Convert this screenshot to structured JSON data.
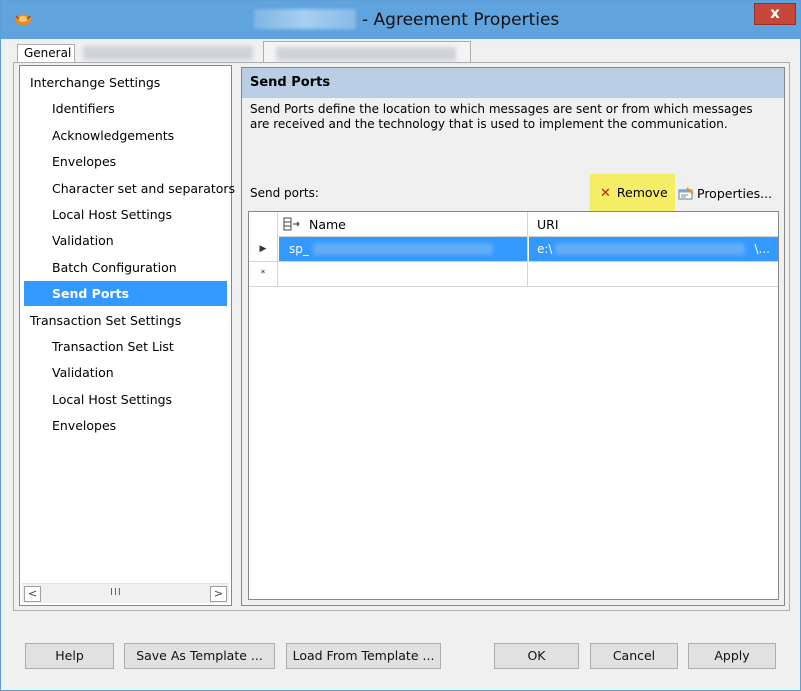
{
  "window": {
    "title": "- Agreement Properties",
    "close_glyph": "x"
  },
  "tabs": {
    "general_label": "General"
  },
  "nav": {
    "items": [
      {
        "label": "Interchange Settings",
        "level": "top"
      },
      {
        "label": "Identifiers",
        "level": "sub"
      },
      {
        "label": "Acknowledgements",
        "level": "sub"
      },
      {
        "label": "Envelopes",
        "level": "sub"
      },
      {
        "label": "Character set and separators",
        "level": "sub"
      },
      {
        "label": "Local Host Settings",
        "level": "sub"
      },
      {
        "label": "Validation",
        "level": "sub"
      },
      {
        "label": "Batch Configuration",
        "level": "sub"
      },
      {
        "label": "Send Ports",
        "level": "sub",
        "selected": true
      },
      {
        "label": "Transaction Set Settings",
        "level": "top"
      },
      {
        "label": "Transaction Set List",
        "level": "sub"
      },
      {
        "label": "Validation",
        "level": "sub"
      },
      {
        "label": "Local Host Settings",
        "level": "sub"
      },
      {
        "label": "Envelopes",
        "level": "sub"
      }
    ],
    "scroll_left": "<",
    "scroll_right": ">",
    "scroll_grip": "III"
  },
  "content": {
    "header": "Send Ports",
    "description": "Send Ports define the location to which messages are sent or from which messages are received and the technology that is used to implement the communication.",
    "send_ports_label": "Send ports:",
    "remove_label": "Remove",
    "properties_label": "Properties..."
  },
  "grid": {
    "columns": [
      "Name",
      "URI"
    ],
    "rows": [
      {
        "indicator": "▶",
        "name": "sp_",
        "uri": "e:\\",
        "uri_end": "\\..."
      },
      {
        "indicator": "*",
        "name": "",
        "uri": "",
        "uri_end": ""
      }
    ]
  },
  "footer": {
    "help": "Help",
    "save_template": "Save As Template ...",
    "load_template": "Load From Template ...",
    "ok": "OK",
    "cancel": "Cancel",
    "apply": "Apply"
  },
  "colors": {
    "titlebar": "#5fa3df",
    "selection": "#3399ff",
    "header_band": "#b9cde5",
    "highlight": "#f5ed66",
    "close": "#c7463a"
  }
}
